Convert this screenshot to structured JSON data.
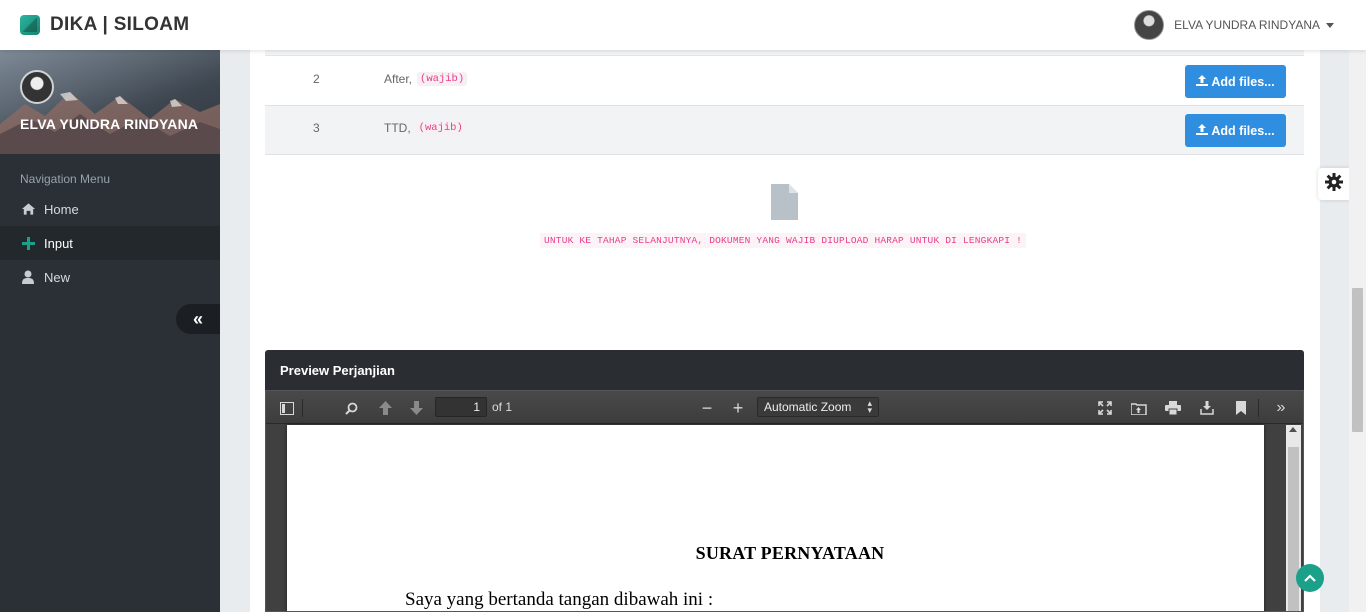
{
  "brand": {
    "title": "DIKA | SILOAM"
  },
  "user": {
    "name": "ELVA YUNDRA RINDYANA"
  },
  "sidebar": {
    "profile_name": "ELVA YUNDRA RINDYANA",
    "heading": "Navigation Menu",
    "items": [
      {
        "label": "Home",
        "icon": "home-icon",
        "active": false
      },
      {
        "label": "Input",
        "icon": "plus-icon",
        "active": true
      },
      {
        "label": "New",
        "icon": "user-icon",
        "active": false
      }
    ]
  },
  "uploads": {
    "rows": [
      {
        "num": "2",
        "label": "After,",
        "tag": "(wajib)",
        "button": "Add files..."
      },
      {
        "num": "3",
        "label": "TTD,",
        "tag": "(wajib)",
        "button": "Add files..."
      }
    ],
    "notice": "UNTUK KE TAHAP SELANJUTNYA, DOKUMEN YANG WAJIB DIUPLOAD HARAP UNTUK DI LENGKAPI !"
  },
  "preview": {
    "title": "Preview Perjanjian",
    "pdf": {
      "page": "1",
      "of": "of 1",
      "zoom": "Automatic Zoom",
      "doc_title": "SURAT PERNYATAAN",
      "doc_line": "Saya yang bertanda tangan dibawah ini :"
    }
  },
  "colors": {
    "accent": "#1ba08a",
    "button": "#2f8ee0",
    "sidebar": "#2a3036",
    "tag": "#e83e8c"
  }
}
